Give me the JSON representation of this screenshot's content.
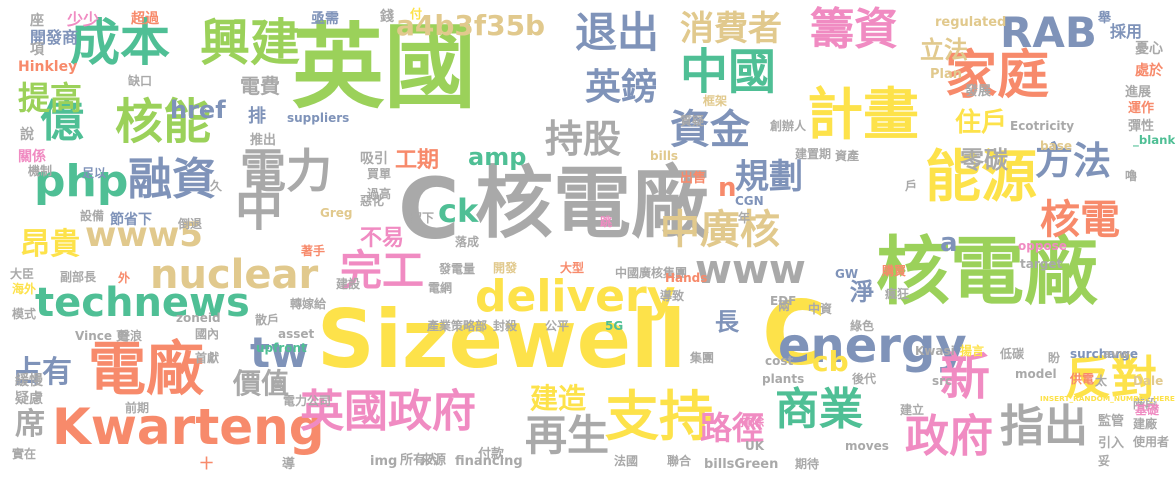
{
  "words": [
    {
      "text": "英國",
      "color": "#9bd15a"
    },
    {
      "text": "核電廠",
      "color": "#a9a9a9"
    },
    {
      "text": "C",
      "color": "#a9a9a9"
    },
    {
      "text": "Sizewell",
      "color": "#fde24a"
    },
    {
      "text": "C",
      "color": "#fde24a"
    },
    {
      "text": "核電廠",
      "color": "#9bd15a"
    },
    {
      "text": "成本",
      "color": "#4fbf95"
    },
    {
      "text": "興建",
      "color": "#9bd15a"
    },
    {
      "text": "計畫",
      "color": "#fde24a"
    },
    {
      "text": "能源",
      "color": "#fde24a"
    },
    {
      "text": "家庭",
      "color": "#f78a6b"
    },
    {
      "text": "RAB",
      "color": "#7f93b9"
    },
    {
      "text": "退出",
      "color": "#7f93b9"
    },
    {
      "text": "中國",
      "color": "#4fbf95"
    },
    {
      "text": "籌資",
      "color": "#f08bc2"
    },
    {
      "text": "消費者",
      "color": "#e1c98d"
    },
    {
      "text": "a4b3f35b",
      "color": "#e1c98d"
    },
    {
      "text": "英鎊",
      "color": "#7f93b9"
    },
    {
      "text": "持股",
      "color": "#a9a9a9"
    },
    {
      "text": "資金",
      "color": "#7f93b9"
    },
    {
      "text": "億",
      "color": "#4fbf95"
    },
    {
      "text": "核能",
      "color": "#9bd15a"
    },
    {
      "text": "提高",
      "color": "#9bd15a"
    },
    {
      "text": "href",
      "color": "#7f93b9"
    },
    {
      "text": "電費",
      "color": "#a9a9a9"
    },
    {
      "text": "排",
      "color": "#7f93b9"
    },
    {
      "text": "電力",
      "color": "#a9a9a9"
    },
    {
      "text": "php",
      "color": "#4fbf95"
    },
    {
      "text": "融資",
      "color": "#7f93b9"
    },
    {
      "text": "中",
      "color": "#a9a9a9"
    },
    {
      "text": "www5",
      "color": "#e1c98d"
    },
    {
      "text": "規劃",
      "color": "#7f93b9"
    },
    {
      "text": "中廣核",
      "color": "#e1c98d"
    },
    {
      "text": "方法",
      "color": "#7f93b9"
    },
    {
      "text": "核電",
      "color": "#f78a6b"
    },
    {
      "text": "不易",
      "color": "#f08bc2"
    },
    {
      "text": "ck",
      "color": "#4fbf95"
    },
    {
      "text": "工期",
      "color": "#f78a6b"
    },
    {
      "text": "amp",
      "color": "#4fbf95"
    },
    {
      "text": "零碳",
      "color": "#a9a9a9"
    },
    {
      "text": "住戶",
      "color": "#fde24a"
    },
    {
      "text": "n",
      "color": "#f78a6b"
    },
    {
      "text": "立法",
      "color": "#e1c98d"
    },
    {
      "text": "昂貴",
      "color": "#fde24a"
    },
    {
      "text": "nuclear",
      "color": "#e1c98d"
    },
    {
      "text": "technews",
      "color": "#4fbf95"
    },
    {
      "text": "完工",
      "color": "#f08bc2"
    },
    {
      "text": "delivery",
      "color": "#fde24a"
    },
    {
      "text": "www",
      "color": "#a9a9a9"
    },
    {
      "text": "tw",
      "color": "#7f93b9"
    },
    {
      "text": "電廠",
      "color": "#f78a6b"
    },
    {
      "text": "價值",
      "color": "#a9a9a9"
    },
    {
      "text": "Kwarteng",
      "color": "#f78a6b"
    },
    {
      "text": "英國政府",
      "color": "#f08bc2"
    },
    {
      "text": "支持",
      "color": "#fde24a"
    },
    {
      "text": "建造",
      "color": "#fde24a"
    },
    {
      "text": "再生",
      "color": "#a9a9a9"
    },
    {
      "text": "energy",
      "color": "#7f93b9"
    },
    {
      "text": "cb",
      "color": "#fde24a"
    },
    {
      "text": "長",
      "color": "#7f93b9"
    },
    {
      "text": "淨",
      "color": "#7f93b9"
    },
    {
      "text": "a",
      "color": "#7f93b9"
    },
    {
      "text": "新",
      "color": "#f08bc2"
    },
    {
      "text": "商業",
      "color": "#4fbf95"
    },
    {
      "text": "路徑",
      "color": "#f08bc2"
    },
    {
      "text": "政府",
      "color": "#f08bc2"
    },
    {
      "text": "指出",
      "color": "#a9a9a9"
    },
    {
      "text": "反對",
      "color": "#fde24a"
    },
    {
      "text": "占有",
      "color": "#7f93b9"
    },
    {
      "text": "席",
      "color": "#a9a9a9"
    },
    {
      "text": "少少",
      "color": "#f08bc2"
    },
    {
      "text": "座",
      "color": "#a9a9a9"
    },
    {
      "text": "開發商",
      "color": "#7f93b9"
    },
    {
      "text": "項",
      "color": "#a9a9a9"
    },
    {
      "text": "Hinkley",
      "color": "#f78a6b"
    },
    {
      "text": "超過",
      "color": "#f78a6b"
    },
    {
      "text": "缺口",
      "color": "#a9a9a9"
    },
    {
      "text": "推出",
      "color": "#a9a9a9"
    },
    {
      "text": "suppliers",
      "color": "#7f93b9"
    },
    {
      "text": "亟需",
      "color": "#7f93b9"
    },
    {
      "text": "錢",
      "color": "#a9a9a9"
    },
    {
      "text": "付",
      "color": "#fde24a"
    },
    {
      "text": "regulated",
      "color": "#e1c98d"
    },
    {
      "text": "Plan",
      "color": "#e1c98d"
    },
    {
      "text": "舉",
      "color": "#7f93b9"
    },
    {
      "text": "採用",
      "color": "#7f93b9"
    },
    {
      "text": "憂心",
      "color": "#a9a9a9"
    },
    {
      "text": "處於",
      "color": "#f78a6b"
    },
    {
      "text": "進展",
      "color": "#a9a9a9"
    },
    {
      "text": "運作",
      "color": "#f78a6b"
    },
    {
      "text": "彈性",
      "color": "#a9a9a9"
    },
    {
      "text": "_blank",
      "color": "#4fbf95"
    },
    {
      "text": "base",
      "color": "#e1c98d"
    },
    {
      "text": "發展",
      "color": "#a9a9a9"
    },
    {
      "text": "Ecotricity",
      "color": "#a9a9a9"
    },
    {
      "text": "創辦人",
      "color": "#a9a9a9"
    },
    {
      "text": "框架",
      "color": "#e1c98d"
    },
    {
      "text": "質疑",
      "color": "#a9a9a9"
    },
    {
      "text": "說",
      "color": "#a9a9a9"
    },
    {
      "text": "關係",
      "color": "#f08bc2"
    },
    {
      "text": "機制",
      "color": "#a9a9a9"
    },
    {
      "text": "足以",
      "color": "#7f93b9"
    },
    {
      "text": "設備",
      "color": "#a9a9a9"
    },
    {
      "text": "節省下",
      "color": "#7f93b9"
    },
    {
      "text": "倒退",
      "color": "#a9a9a9"
    },
    {
      "text": "久",
      "color": "#a9a9a9"
    },
    {
      "text": "吸引",
      "color": "#a9a9a9"
    },
    {
      "text": "買單",
      "color": "#a9a9a9"
    },
    {
      "text": "過高",
      "color": "#a9a9a9"
    },
    {
      "text": "Greg",
      "color": "#e1c98d"
    },
    {
      "text": "惡化",
      "color": "#a9a9a9"
    },
    {
      "text": "留下",
      "color": "#a9a9a9"
    },
    {
      "text": "著手",
      "color": "#f78a6b"
    },
    {
      "text": "落成",
      "color": "#a9a9a9"
    },
    {
      "text": "跳",
      "color": "#f08bc2"
    },
    {
      "text": "bills",
      "color": "#e1c98d"
    },
    {
      "text": "出售",
      "color": "#f78a6b"
    },
    {
      "text": "CGN",
      "color": "#7f93b9"
    },
    {
      "text": "年",
      "color": "#a9a9a9"
    },
    {
      "text": "建置期",
      "color": "#a9a9a9"
    },
    {
      "text": "資產",
      "color": "#a9a9a9"
    },
    {
      "text": "戶",
      "color": "#a9a9a9"
    },
    {
      "text": "嚕",
      "color": "#a9a9a9"
    },
    {
      "text": "oppose",
      "color": "#f08bc2"
    },
    {
      "text": "target",
      "color": "#a9a9a9"
    },
    {
      "text": "購買",
      "color": "#f78a6b"
    },
    {
      "text": "瘋狂",
      "color": "#a9a9a9"
    },
    {
      "text": "GW",
      "color": "#7f93b9"
    },
    {
      "text": "大臣",
      "color": "#a9a9a9"
    },
    {
      "text": "副部長",
      "color": "#a9a9a9"
    },
    {
      "text": "外",
      "color": "#f78a6b"
    },
    {
      "text": "海外",
      "color": "#fde24a"
    },
    {
      "text": "模式",
      "color": "#a9a9a9"
    },
    {
      "text": "建設",
      "color": "#a9a9a9"
    },
    {
      "text": "轉嫁給",
      "color": "#a9a9a9"
    },
    {
      "text": "散戶",
      "color": "#a9a9a9"
    },
    {
      "text": "發電量",
      "color": "#a9a9a9"
    },
    {
      "text": "電網",
      "color": "#a9a9a9"
    },
    {
      "text": "開發",
      "color": "#e1c98d"
    },
    {
      "text": "大型",
      "color": "#f78a6b"
    },
    {
      "text": "中國廣核集團",
      "color": "#a9a9a9"
    },
    {
      "text": "Hands",
      "color": "#f78a6b"
    },
    {
      "text": "導致",
      "color": "#a9a9a9"
    },
    {
      "text": "EDF",
      "color": "#a9a9a9"
    },
    {
      "text": "兩",
      "color": "#a9a9a9"
    },
    {
      "text": "中資",
      "color": "#a9a9a9"
    },
    {
      "text": "綠色",
      "color": "#a9a9a9"
    },
    {
      "text": "Vince 更",
      "color": "#a9a9a9"
    },
    {
      "text": "聲浪",
      "color": "#a9a9a9"
    },
    {
      "text": "zoneid",
      "color": "#a9a9a9"
    },
    {
      "text": "產業策略部",
      "color": "#a9a9a9"
    },
    {
      "text": "封殺",
      "color": "#a9a9a9"
    },
    {
      "text": "公平",
      "color": "#a9a9a9"
    },
    {
      "text": "5G",
      "color": "#4fbf95"
    },
    {
      "text": "國內",
      "color": "#a9a9a9"
    },
    {
      "text": "asset",
      "color": "#a9a9a9"
    },
    {
      "text": "首獻",
      "color": "#a9a9a9"
    },
    {
      "text": "upfront",
      "color": "#4fbf95"
    },
    {
      "text": "集團",
      "color": "#a9a9a9"
    },
    {
      "text": "Kwasi",
      "color": "#a9a9a9"
    },
    {
      "text": "揚言",
      "color": "#fde24a"
    },
    {
      "text": "低碳",
      "color": "#a9a9a9"
    },
    {
      "text": "盼",
      "color": "#a9a9a9"
    },
    {
      "text": "surcharge",
      "color": "#7f93b9"
    },
    {
      "text": "avw",
      "color": "#a9a9a9"
    },
    {
      "text": "緩慢",
      "color": "#a9a9a9"
    },
    {
      "text": "疑慮",
      "color": "#a9a9a9"
    },
    {
      "text": "萬",
      "color": "#a9a9a9"
    },
    {
      "text": "電力公司",
      "color": "#a9a9a9"
    },
    {
      "text": "cost",
      "color": "#a9a9a9"
    },
    {
      "text": "plants",
      "color": "#a9a9a9"
    },
    {
      "text": "後代",
      "color": "#a9a9a9"
    },
    {
      "text": "model",
      "color": "#a9a9a9"
    },
    {
      "text": "src",
      "color": "#a9a9a9"
    },
    {
      "text": "供電",
      "color": "#f78a6b"
    },
    {
      "text": "太",
      "color": "#a9a9a9"
    },
    {
      "text": "Dale",
      "color": "#e1c98d"
    },
    {
      "text": "階段",
      "color": "#a9a9a9"
    },
    {
      "text": "建廠",
      "color": "#a9a9a9"
    },
    {
      "text": "使用者",
      "color": "#a9a9a9"
    },
    {
      "text": "前期",
      "color": "#a9a9a9"
    },
    {
      "text": "排除",
      "color": "#f08bc2"
    },
    {
      "text": "建立",
      "color": "#a9a9a9"
    },
    {
      "text": "INSERT_RANDOM_NUMBER_HERE",
      "color": "#fde24a"
    },
    {
      "text": "基礎",
      "color": "#f08bc2"
    },
    {
      "text": "監管",
      "color": "#a9a9a9"
    },
    {
      "text": "引入",
      "color": "#a9a9a9"
    },
    {
      "text": "實在",
      "color": "#a9a9a9"
    },
    {
      "text": "UK",
      "color": "#a9a9a9"
    },
    {
      "text": "img",
      "color": "#a9a9a9"
    },
    {
      "text": "所有人",
      "color": "#a9a9a9"
    },
    {
      "text": "來源",
      "color": "#a9a9a9"
    },
    {
      "text": "financing",
      "color": "#a9a9a9"
    },
    {
      "text": "付款",
      "color": "#a9a9a9"
    },
    {
      "text": "法國",
      "color": "#a9a9a9"
    },
    {
      "text": "聯合",
      "color": "#a9a9a9"
    },
    {
      "text": "billsGreen",
      "color": "#a9a9a9"
    },
    {
      "text": "期待",
      "color": "#a9a9a9"
    },
    {
      "text": "moves",
      "color": "#a9a9a9"
    },
    {
      "text": "妥",
      "color": "#a9a9a9"
    },
    {
      "text": "十",
      "color": "#f78a6b"
    },
    {
      "text": "導",
      "color": "#a9a9a9"
    }
  ]
}
